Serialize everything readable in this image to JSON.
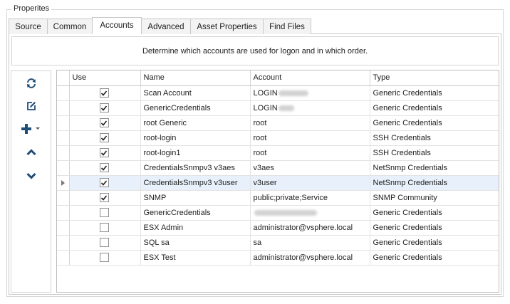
{
  "groupbox": {
    "title": "Properites"
  },
  "tabs": [
    {
      "label": "Source",
      "active": false
    },
    {
      "label": "Common",
      "active": false
    },
    {
      "label": "Accounts",
      "active": true
    },
    {
      "label": "Advanced",
      "active": false
    },
    {
      "label": "Asset Properties",
      "active": false
    },
    {
      "label": "Find Files",
      "active": false
    }
  ],
  "description": "Determine which accounts are used for logon and in which order.",
  "toolbar": {
    "icons": [
      "refresh-icon",
      "edit-icon",
      "add-icon",
      "dropdown-arrow-icon",
      "move-up-icon",
      "move-down-icon"
    ],
    "accent_color": "#1f4e79"
  },
  "grid": {
    "columns": [
      "Use",
      "Name",
      "Account",
      "Type"
    ],
    "selected_row_color": "#e8f1fb",
    "rows": [
      {
        "use": true,
        "name": "Scan Account",
        "account": "LOGIN",
        "account_redacted": true,
        "type": "Generic Credentials"
      },
      {
        "use": true,
        "name": "GenericCredentials",
        "account": "LOGIN",
        "account_redacted": true,
        "type": "Generic Credentials"
      },
      {
        "use": true,
        "name": "root Generic",
        "account": "root",
        "account_redacted": false,
        "type": "Generic Credentials"
      },
      {
        "use": true,
        "name": "root-login",
        "account": "root",
        "account_redacted": false,
        "type": "SSH Credentials"
      },
      {
        "use": true,
        "name": "root-login1",
        "account": "root",
        "account_redacted": false,
        "type": "SSH Credentials"
      },
      {
        "use": true,
        "name": "CredentialsSnmpv3 v3aes",
        "account": "v3aes",
        "account_redacted": false,
        "type": "NetSnmp Credentials"
      },
      {
        "use": true,
        "name": "CredentialsSnmpv3 v3user",
        "account": "v3user",
        "account_redacted": false,
        "type": "NetSnmp Credentials",
        "current": true
      },
      {
        "use": true,
        "name": "SNMP",
        "account": "public;private;Service",
        "account_redacted": false,
        "type": "SNMP Community"
      },
      {
        "use": false,
        "name": "GenericCredentials",
        "account": "",
        "account_redacted": true,
        "type": "Generic Credentials"
      },
      {
        "use": false,
        "name": "ESX Admin",
        "account": "administrator@vsphere.local",
        "account_redacted": false,
        "type": "Generic Credentials"
      },
      {
        "use": false,
        "name": "SQL sa",
        "account": "sa",
        "account_redacted": false,
        "type": "Generic Credentials"
      },
      {
        "use": false,
        "name": "ESX Test",
        "account": "administrator@vsphere.local",
        "account_redacted": false,
        "type": "Generic Credentials"
      }
    ]
  }
}
